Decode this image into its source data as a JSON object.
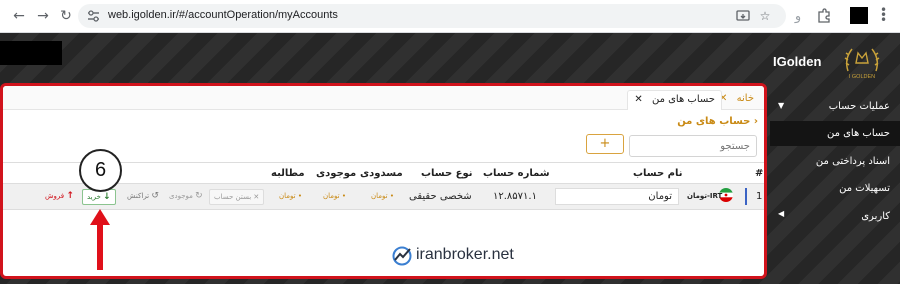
{
  "browser": {
    "url": "web.igolden.ir/#/accountOperation/myAccounts"
  },
  "brand": {
    "name": "IGolden",
    "logo_text": "I GOLDEN"
  },
  "sidebar": {
    "items": [
      {
        "label": "عملیات حساب"
      },
      {
        "label": "حساب های من"
      },
      {
        "label": "اسناد پرداختی من"
      },
      {
        "label": "تسهیلات من"
      },
      {
        "label": "کاربری"
      }
    ]
  },
  "tabs": [
    {
      "label": "خانه"
    },
    {
      "label": "حساب های من"
    }
  ],
  "page": {
    "title": "حساب های من",
    "search_placeholder": "جستجو",
    "add_label": "+"
  },
  "table": {
    "headers": {
      "index": "#",
      "name": "نام حساب",
      "number": "شماره حساب",
      "type": "نوع حساب",
      "blocked": "مسدودی",
      "balance": "موجودی",
      "claim": "مطالبه"
    },
    "row": {
      "index": "1",
      "currency_code": "IRT-تومان",
      "name": "تومان",
      "number": "۱۲.۸۵۷۱.۱",
      "type": "شخصی حقیقی",
      "blocked": "• تومان",
      "balance": "• تومان",
      "claim": "• تومان"
    },
    "actions": {
      "close": "بستن حساب",
      "inventory": "موجودی",
      "transactions": "تراکنش",
      "buy": "خرید",
      "sell": "فروش"
    }
  },
  "annotation": {
    "step": "6"
  },
  "watermark": {
    "text": "iranbroker.net"
  },
  "colors": {
    "highlight_border": "#d1131c",
    "gold_accent": "#c98a15",
    "buy_green": "#2e7d32",
    "sell_red": "#d1131c"
  }
}
